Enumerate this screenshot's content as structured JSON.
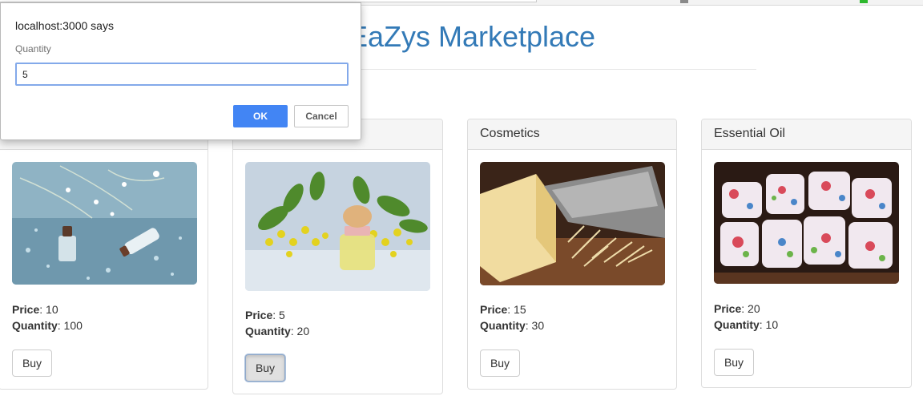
{
  "page": {
    "title": "EaZys Marketplace"
  },
  "dialog": {
    "title": "localhost:3000 says",
    "message": "Quantity",
    "input_value": "5",
    "ok_label": "OK",
    "cancel_label": "Cancel"
  },
  "products": [
    {
      "name": "",
      "price_label": "Price",
      "price": ": 10",
      "qty_label": "Quantity",
      "qty": ": 100",
      "buy_label": "Buy",
      "image": "perfume-bottles-icon"
    },
    {
      "name": "",
      "price_label": "Price",
      "price": ": 5",
      "qty_label": "Quantity",
      "qty": ": 20",
      "buy_label": "Buy",
      "image": "oil-flowers-icon"
    },
    {
      "name": "Cosmetics",
      "price_label": "Price",
      "price": ": 15",
      "qty_label": "Quantity",
      "qty": ": 30",
      "buy_label": "Buy",
      "image": "cheese-grater-icon"
    },
    {
      "name": "Essential Oil",
      "price_label": "Price",
      "price": ": 20",
      "qty_label": "Quantity",
      "qty": ": 10",
      "buy_label": "Buy",
      "image": "floral-mugs-icon"
    }
  ],
  "colors": {
    "title": "#337ab7",
    "ok_button": "#4285f4",
    "input_focus": "#83a9ea"
  }
}
